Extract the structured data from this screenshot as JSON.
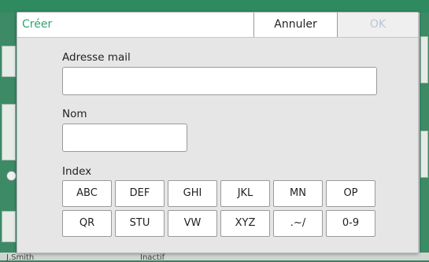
{
  "background": {
    "user_text": "J.Smith",
    "status_text": "Inactif"
  },
  "dialog": {
    "title": "Créer",
    "cancel_label": "Annuler",
    "ok_label": "OK",
    "email": {
      "label": "Adresse mail",
      "value": "",
      "placeholder": ""
    },
    "name": {
      "label": "Nom",
      "value": "",
      "placeholder": ""
    },
    "index": {
      "label": "Index",
      "buttons": [
        "ABC",
        "DEF",
        "GHI",
        "JKL",
        "MN",
        "OP",
        "QR",
        "STU",
        "VW",
        "XYZ",
        ".~/",
        "0-9"
      ]
    }
  },
  "colors": {
    "title": "#2fa36e",
    "ok_disabled": "#b9c6d6",
    "app_accent": "#3c8a66"
  }
}
